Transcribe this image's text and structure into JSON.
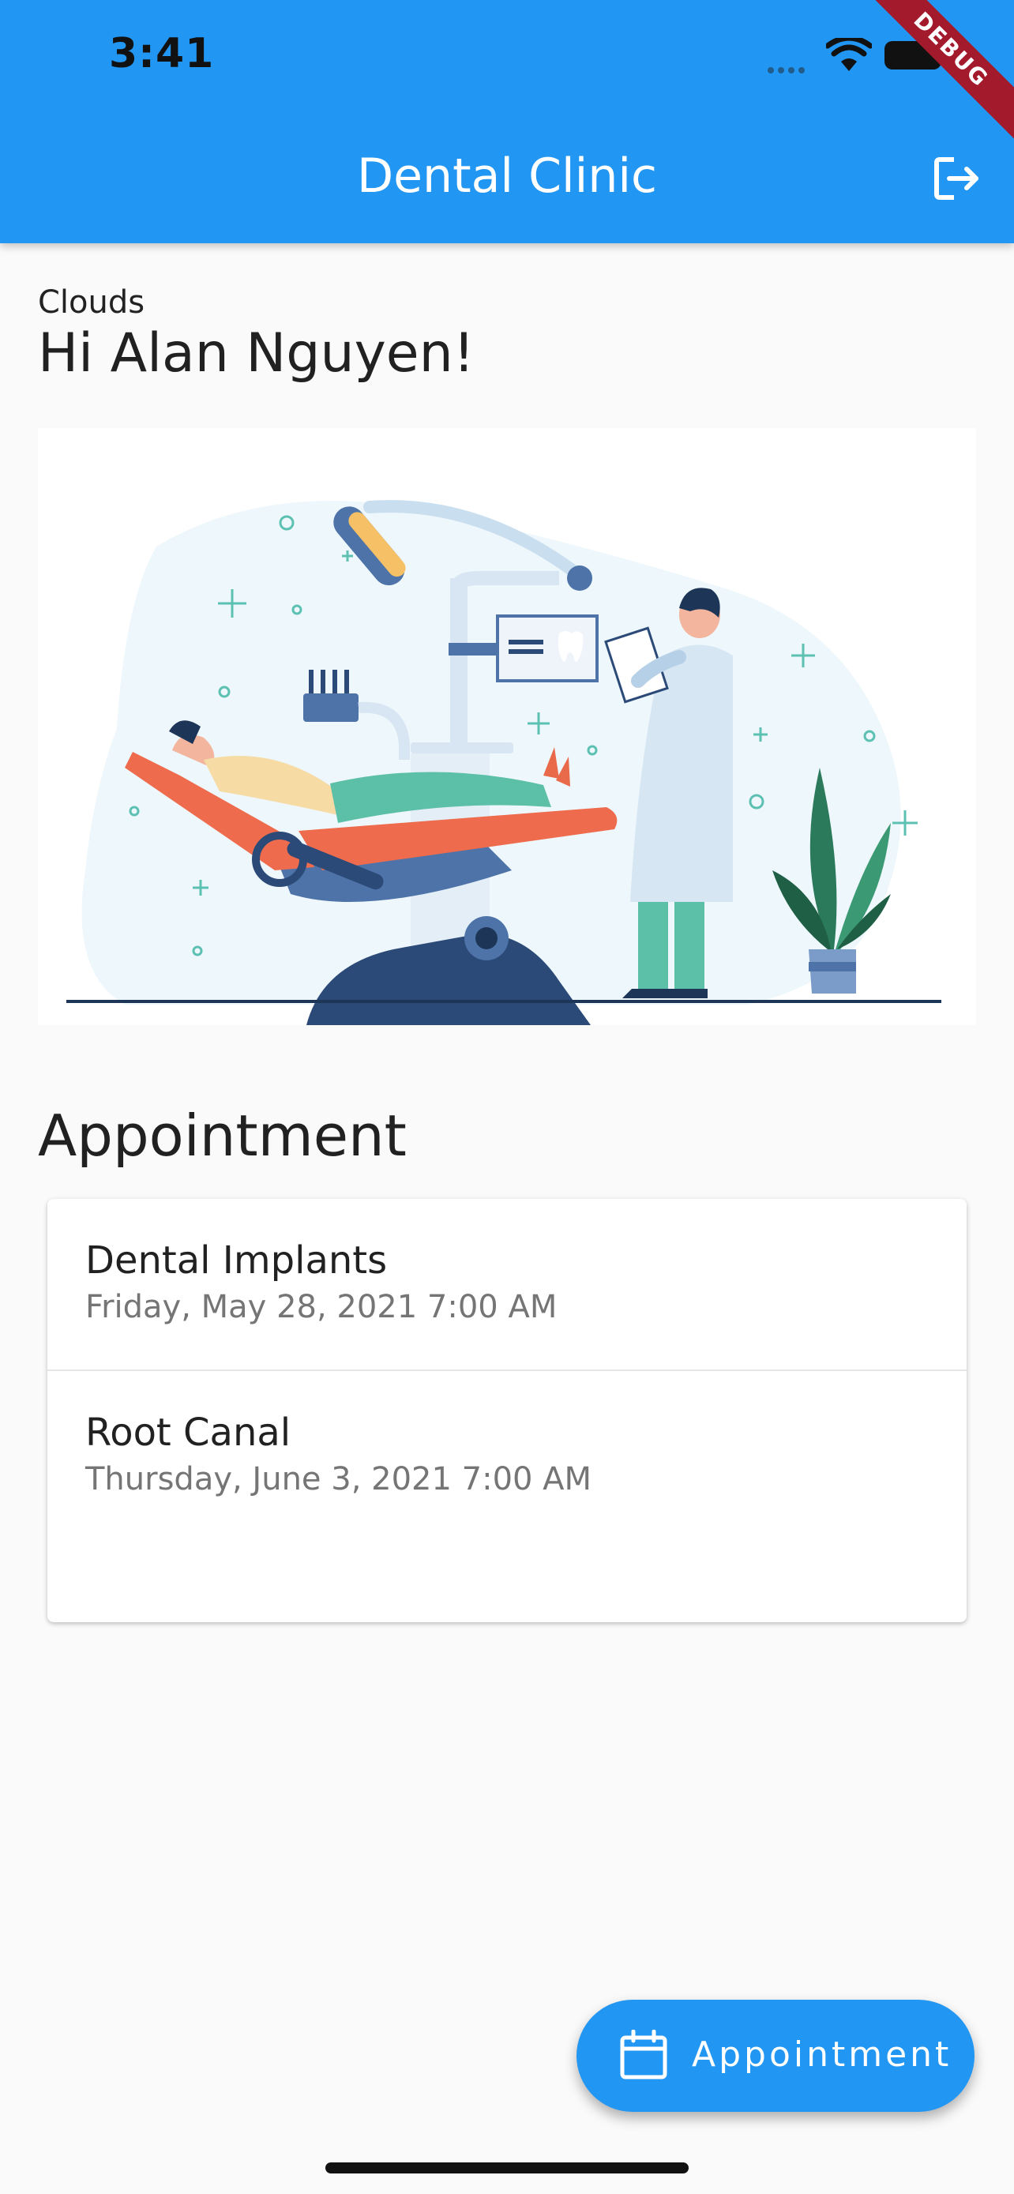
{
  "status_bar": {
    "time": "3:41"
  },
  "debug_banner": "DEBUG",
  "app_bar": {
    "title": "Dental Clinic",
    "action_icon": "logout-icon"
  },
  "header": {
    "location": "Clouds",
    "greeting": "Hi Alan Nguyen!"
  },
  "illustration": {
    "subject": "dental-clinic-illustration"
  },
  "appointments_section": {
    "title": "Appointment",
    "items": [
      {
        "name": "Dental Implants",
        "datetime": "Friday, May 28, 2021 7:00 AM"
      },
      {
        "name": "Root Canal",
        "datetime": "Thursday, June 3, 2021 7:00 AM"
      }
    ]
  },
  "fab": {
    "label": "Appointment",
    "icon": "calendar-icon"
  },
  "colors": {
    "primary": "#2196f3",
    "background": "#fafafa",
    "text": "#212121",
    "secondary_text": "#757575"
  }
}
